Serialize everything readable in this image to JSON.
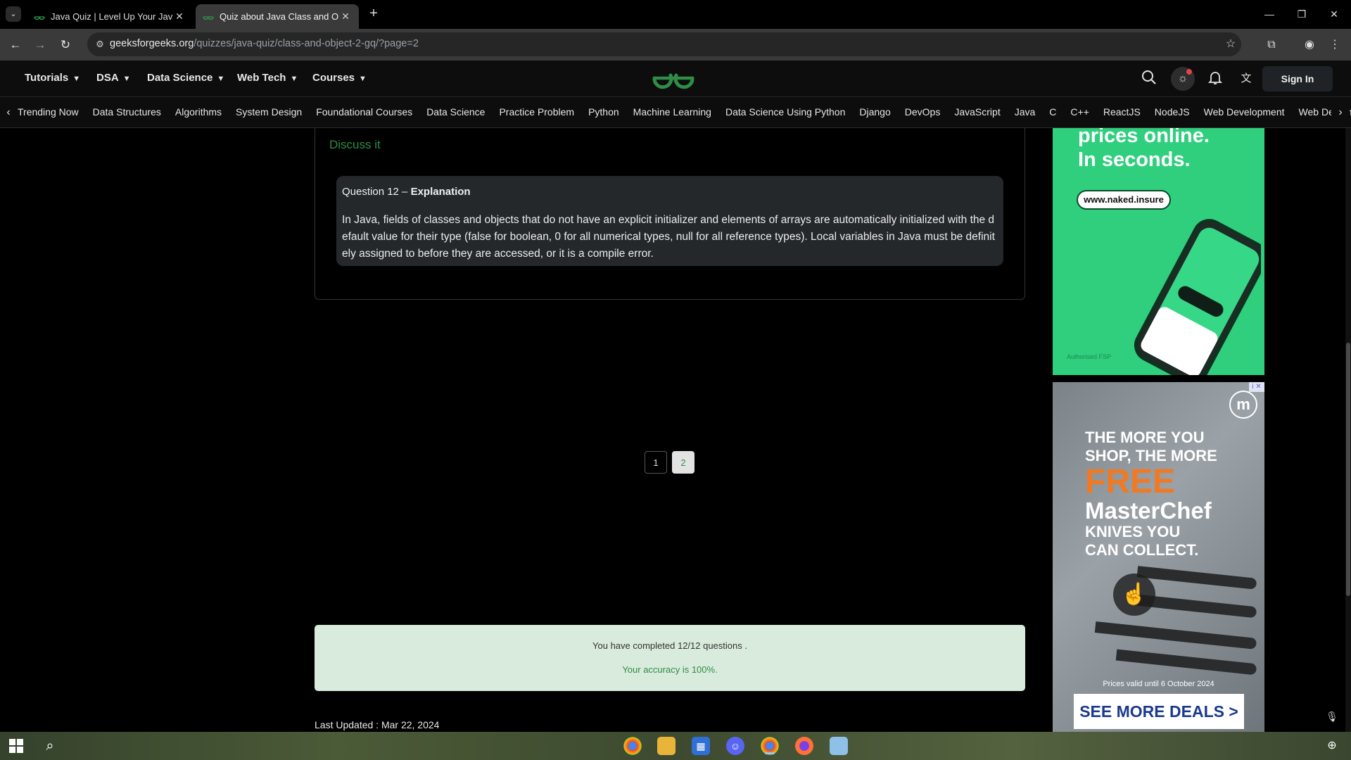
{
  "browser": {
    "tabs": [
      {
        "title": "Java Quiz | Level Up Your Java S",
        "active": false
      },
      {
        "title": "Quiz about Java Class and Obje",
        "active": true
      }
    ],
    "new_tab": "+",
    "url_domain": "geeksforgeeks.org",
    "url_path": "/quizzes/java-quiz/class-and-object-2-gq/?page=2",
    "controls": {
      "minimize": "—",
      "restore": "❐",
      "close": "✕"
    }
  },
  "gfg_header": {
    "menus": [
      "Tutorials",
      "DSA",
      "Data Science",
      "Web Tech",
      "Courses"
    ],
    "sign_in": "Sign In"
  },
  "subnav": {
    "items": [
      "Trending Now",
      "Data Structures",
      "Algorithms",
      "System Design",
      "Foundational Courses",
      "Data Science",
      "Practice Problem",
      "Python",
      "Machine Learning",
      "Data Science Using Python",
      "Django",
      "DevOps",
      "JavaScript",
      "Java",
      "C",
      "C++",
      "ReactJS",
      "NodeJS",
      "Web Development",
      "Web Design",
      "W"
    ]
  },
  "question": {
    "discuss_label": "Discuss it",
    "explanation_prefix": "Question 12 – ",
    "explanation_title": "Explanation",
    "explanation_text": "In Java, fields of classes and objects that do not have an explicit initializer and elements of arrays are automatically initialized with the default value for their type (false for boolean, 0 for all numerical types, null for all reference types). Local variables in Java must be definitely assigned to before they are accessed, or it is a compile error."
  },
  "pagination": {
    "pages": [
      "1",
      "2"
    ],
    "current": "2"
  },
  "result": {
    "completed_text": "You have completed 12/12 questions .",
    "accuracy_text": "Your accuracy is 100%."
  },
  "last_updated": "Last Updated : Mar 22, 2024",
  "ads": {
    "ad1": {
      "headline_1": "prices online.",
      "headline_2": "In seconds.",
      "url": "www.naked.insure",
      "footer": "Authorised FSP"
    },
    "ad2": {
      "line1": "THE MORE YOU",
      "line2": "SHOP, THE MORE",
      "free": "FREE",
      "brand": "MasterChef",
      "line3": "KNIVES YOU",
      "line4": "CAN COLLECT.",
      "valid": "Prices valid until 6 October 2024",
      "cta": "SEE MORE DEALS >"
    }
  },
  "colors": {
    "gfg_green": "#2f8d46",
    "result_bg": "#d9ebdd",
    "chrome_dark": "#3a3a3a"
  }
}
